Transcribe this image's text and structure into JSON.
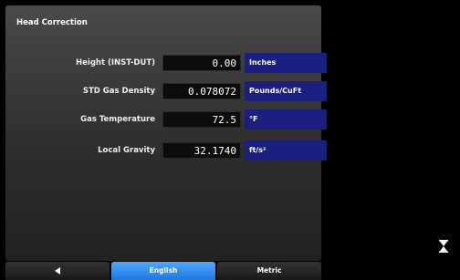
{
  "title": "Head Correction",
  "rows": [
    {
      "label": "Height (INST-DUT)",
      "value": "0.00",
      "unit": "Inches"
    },
    {
      "label": "STD Gas Density",
      "value": "0.078072",
      "unit": "Pounds/CuFt"
    },
    {
      "label": "Gas Temperature",
      "value": "72.5",
      "unit": "°F"
    },
    {
      "label": "Local Gravity",
      "value": "32.1740",
      "unit": "ft/s²"
    }
  ],
  "bottom_bar": {
    "back_icon": "arrow-left-icon",
    "english_label": "English",
    "metric_label": "Metric",
    "selected": "English"
  },
  "side_icon": "hourglass-icon",
  "colors": {
    "unit_bg": "#1b2080",
    "active_tab": "#3a96f5",
    "panel_bg": "#3a3a3a"
  }
}
